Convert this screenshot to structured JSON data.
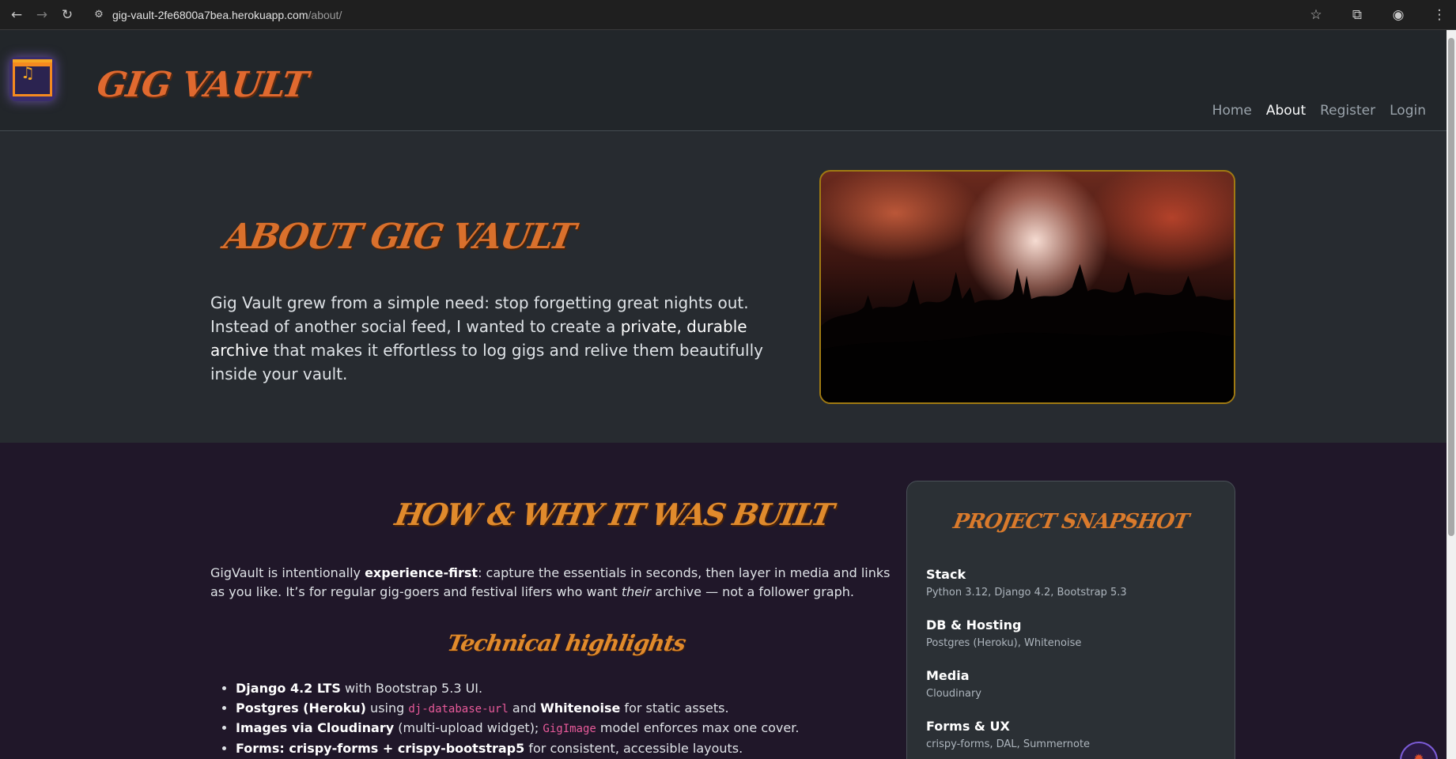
{
  "browser": {
    "url_host": "gig-vault-2fe6800a7bea.herokuapp.com",
    "url_path": "/about/",
    "icons": [
      "back-arrow-icon",
      "forward-arrow-icon",
      "reload-icon",
      "site-info-icon",
      "bookmark-star-icon",
      "extensions-icon",
      "profile-icon",
      "menu-dots-icon"
    ]
  },
  "site": {
    "brand": "GIG VAULT",
    "nav": [
      {
        "label": "Home"
      },
      {
        "label": "About",
        "active": true
      },
      {
        "label": "Register"
      },
      {
        "label": "Login"
      }
    ]
  },
  "hero": {
    "title": "ABOUT GIG VAULT",
    "text_part1": "Gig Vault grew from a simple need: stop forgetting great nights out. Instead of another social feed, I wanted to create a ",
    "text_strong": "private, durable archive",
    "text_part2": " that makes it effortless to log gigs and relive them beautifully inside your vault."
  },
  "how": {
    "title": "HOW & WHY IT WAS BUILT",
    "intro_part1": "GigVault is intentionally ",
    "intro_strong": "experience-first",
    "intro_part2": ": capture the essentials in seconds, then layer in media and links as you like. It’s for regular gig-goers and festival lifers who want ",
    "intro_em": "their",
    "intro_part3": " archive — not a follower graph.",
    "tech_title": "Technical highlights",
    "highlights": [
      {
        "strong": "Django 4.2 LTS",
        "rest": " with Bootstrap 5.3 UI."
      },
      {
        "strong": "Postgres (Heroku)",
        "mid": " using ",
        "code": "dj-database-url",
        "mid2": " and ",
        "strong2": "Whitenoise",
        "rest": " for static assets."
      },
      {
        "strong": "Images via Cloudinary",
        "mid": " (multi-upload widget); ",
        "code": "GigImage",
        "rest": " model enforces max one cover."
      },
      {
        "strong": "Forms: crispy-forms + crispy-bootstrap5",
        "rest": " for consistent, accessible layouts."
      }
    ]
  },
  "snapshot": {
    "title": "PROJECT SNAPSHOT",
    "items": [
      {
        "key": "Stack",
        "value": "Python 3.12, Django 4.2, Bootstrap 5.3"
      },
      {
        "key": "DB & Hosting",
        "value": "Postgres (Heroku), Whitenoise"
      },
      {
        "key": "Media",
        "value": "Cloudinary"
      },
      {
        "key": "Forms & UX",
        "value": "crispy-forms, DAL, Summernote"
      }
    ]
  },
  "colors": {
    "accent_orange": "#e0692f",
    "hero_bg": "#272b30",
    "lower_bg": "#201729",
    "photo_border": "#a07a12"
  }
}
